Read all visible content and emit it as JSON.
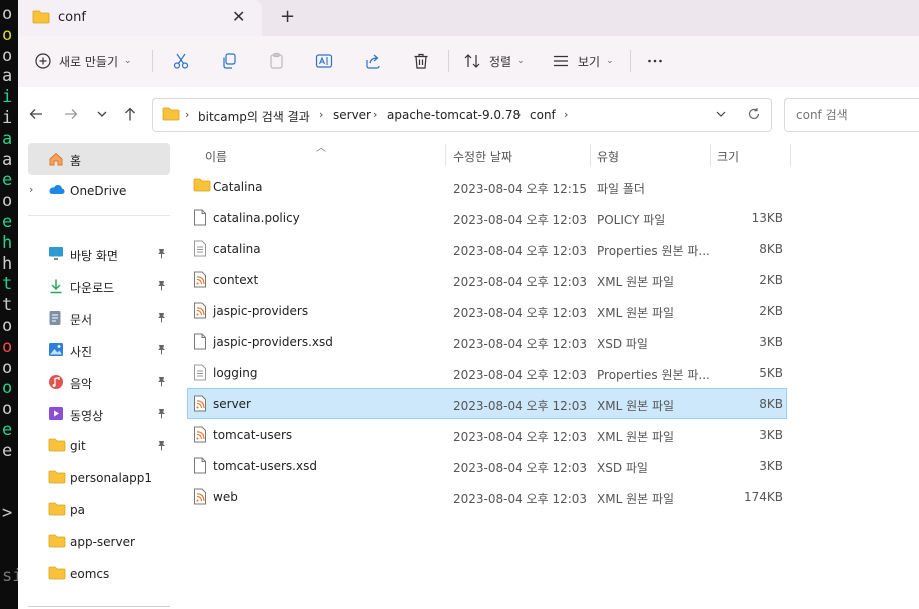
{
  "terminal": {
    "lines": [
      {
        "text": "o",
        "color": "#cccccc"
      },
      {
        "text": "o",
        "color": "#d8d836"
      },
      {
        "text": "o",
        "color": "#cccccc"
      },
      {
        "text": "a",
        "color": "#cccccc"
      },
      {
        "text": "i",
        "color": "#23d18b"
      },
      {
        "text": "i",
        "color": "#cccccc"
      },
      {
        "text": "a",
        "color": "#23d18b"
      },
      {
        "text": "a",
        "color": "#cccccc"
      },
      {
        "text": "e",
        "color": "#23d18b"
      },
      {
        "text": "o",
        "color": "#cccccc"
      },
      {
        "text": "e",
        "color": "#23d18b"
      },
      {
        "text": "h",
        "color": "#23d18b"
      },
      {
        "text": "h",
        "color": "#cccccc"
      },
      {
        "text": "t",
        "color": "#23d18b"
      },
      {
        "text": "t",
        "color": "#cccccc"
      },
      {
        "text": "o",
        "color": "#cccccc"
      },
      {
        "text": "o",
        "color": "#f14c4c"
      },
      {
        "text": "o",
        "color": "#cccccc"
      },
      {
        "text": "o",
        "color": "#23d18b"
      },
      {
        "text": "o",
        "color": "#cccccc"
      },
      {
        "text": "e",
        "color": "#23d18b"
      },
      {
        "text": "e",
        "color": "#cccccc"
      },
      {
        "text": "",
        "color": "#cccccc"
      },
      {
        "text": "",
        "color": "#cccccc"
      },
      {
        "text": ">",
        "color": "#cccccc"
      },
      {
        "text": "",
        "color": "#cccccc"
      },
      {
        "text": "",
        "color": "#cccccc"
      },
      {
        "text": "si",
        "color": "#777777"
      }
    ]
  },
  "tab": {
    "title": "conf"
  },
  "toolbar": {
    "new_label": "새로 만들기",
    "sort_label": "정렬",
    "view_label": "보기"
  },
  "address": {
    "crumbs": [
      "bitcamp의 검색 결과",
      "server",
      "apache-tomcat-9.0.78",
      "conf"
    ]
  },
  "search": {
    "placeholder": "conf 검색"
  },
  "sidebar": {
    "home": "홈",
    "onedrive": "OneDrive",
    "items": [
      {
        "label": "바탕 화면",
        "icon": "desktop-icon"
      },
      {
        "label": "다운로드",
        "icon": "download-icon"
      },
      {
        "label": "문서",
        "icon": "documents-icon"
      },
      {
        "label": "사진",
        "icon": "pictures-icon"
      },
      {
        "label": "음악",
        "icon": "music-icon"
      },
      {
        "label": "동영상",
        "icon": "videos-icon"
      },
      {
        "label": "git",
        "icon": "folder-icon"
      },
      {
        "label": "personalapp1",
        "icon": "folder-icon"
      },
      {
        "label": "pa",
        "icon": "folder-icon"
      },
      {
        "label": "app-server",
        "icon": "folder-icon"
      },
      {
        "label": "eomcs",
        "icon": "folder-icon"
      }
    ]
  },
  "columns": {
    "name": "이름",
    "date": "수정한 날짜",
    "type": "유형",
    "size": "크기"
  },
  "files": [
    {
      "name": "Catalina",
      "date": "2023-08-04 오후 12:15",
      "type": "파일 폴더",
      "size": "",
      "icon": "folder-icon"
    },
    {
      "name": "catalina.policy",
      "date": "2023-08-04 오후 12:03",
      "type": "POLICY 파일",
      "size": "13KB",
      "icon": "file-icon"
    },
    {
      "name": "catalina",
      "date": "2023-08-04 오후 12:03",
      "type": "Properties 원본 파...",
      "size": "8KB",
      "icon": "text-file-icon"
    },
    {
      "name": "context",
      "date": "2023-08-04 오후 12:03",
      "type": "XML 원본 파일",
      "size": "2KB",
      "icon": "xml-file-icon"
    },
    {
      "name": "jaspic-providers",
      "date": "2023-08-04 오후 12:03",
      "type": "XML 원본 파일",
      "size": "2KB",
      "icon": "xml-file-icon"
    },
    {
      "name": "jaspic-providers.xsd",
      "date": "2023-08-04 오후 12:03",
      "type": "XSD 파일",
      "size": "3KB",
      "icon": "file-icon"
    },
    {
      "name": "logging",
      "date": "2023-08-04 오후 12:03",
      "type": "Properties 원본 파...",
      "size": "5KB",
      "icon": "text-file-icon"
    },
    {
      "name": "server",
      "date": "2023-08-04 오후 12:03",
      "type": "XML 원본 파일",
      "size": "8KB",
      "icon": "xml-file-icon",
      "selected": true
    },
    {
      "name": "tomcat-users",
      "date": "2023-08-04 오후 12:03",
      "type": "XML 원본 파일",
      "size": "3KB",
      "icon": "xml-file-icon"
    },
    {
      "name": "tomcat-users.xsd",
      "date": "2023-08-04 오후 12:03",
      "type": "XSD 파일",
      "size": "3KB",
      "icon": "file-icon"
    },
    {
      "name": "web",
      "date": "2023-08-04 오후 12:03",
      "type": "XML 원본 파일",
      "size": "174KB",
      "icon": "xml-file-icon"
    }
  ]
}
